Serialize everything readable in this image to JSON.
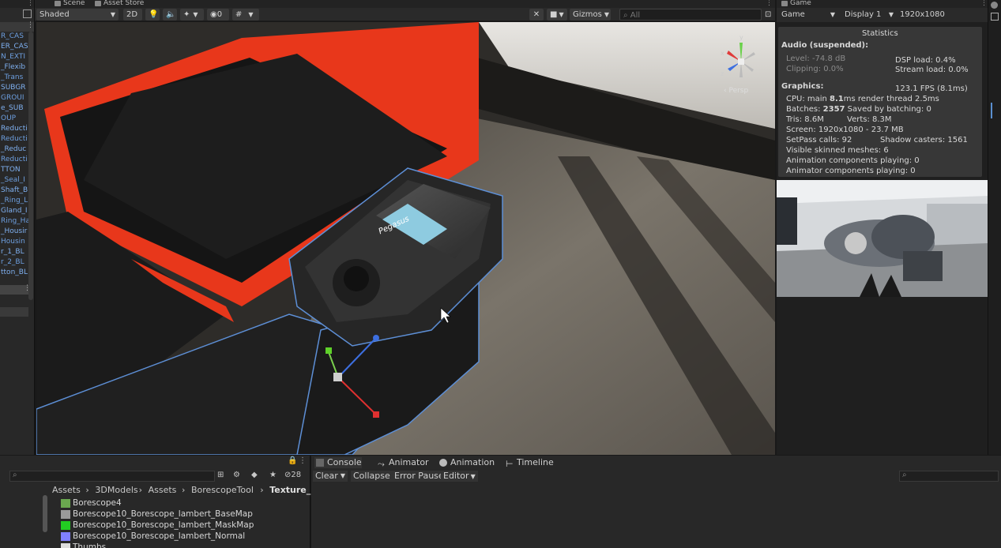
{
  "scene_tabs": {
    "scene": "Scene",
    "asset_store": "Asset Store"
  },
  "scene_toolbar": {
    "shading": "Shaded",
    "mode_2d": "2D",
    "hidden_count": "0",
    "gizmos": "Gizmos",
    "search_placeholder": "All",
    "persp_label": "‹ Persp"
  },
  "hierarchy_items": [
    "R_CAS",
    "ER_CAS",
    "N_EXTI",
    "_Flexib",
    "_Trans",
    "SUBGR",
    "GROUI",
    "e_SUB",
    "OUP",
    "Reducti",
    "Reducti",
    "_Reduc",
    "Reducti",
    "TTON",
    "_Seal_I",
    "Shaft_B",
    "_Ring_L",
    "Gland_I",
    "Ring_Ha",
    "_Housir",
    "Housin",
    "r_1_BL",
    "r_2_BL",
    "tton_BL"
  ],
  "game": {
    "tab": "Game",
    "view": "Game",
    "display": "Display 1",
    "resolution": "1920x1080"
  },
  "stats": {
    "title": "Statistics",
    "audio_header": "Audio (suspended):",
    "level": "Level: -74.8 dB",
    "clipping": "Clipping: 0.0%",
    "dsp": "DSP load: 0.4%",
    "stream": "Stream load: 0.0%",
    "graphics_header": "Graphics:",
    "fps": "123.1 FPS (8.1ms)",
    "cpu_a": "CPU: main ",
    "cpu_b": "8.1",
    "cpu_c": "ms  render thread 2.5ms",
    "batches_a": "Batches: ",
    "batches_b": "2357",
    "batches_c": "  Saved by batching: 0",
    "tris": "Tris: 8.6M",
    "verts": "Verts: 8.3M",
    "screen": "Screen: 1920x1080 - 23.7 MB",
    "setpass": "SetPass calls: 92",
    "shadow": "Shadow casters: 1561",
    "skinned": "Visible skinned meshes: 6",
    "anim": "Animation components playing: 0",
    "animator": "Animator components playing: 0"
  },
  "device_label": "Pegasus",
  "bottom_tabs": {
    "console": "Console",
    "animator": "Animator",
    "animation": "Animation",
    "timeline": "Timeline"
  },
  "console_buttons": {
    "clear": "Clear",
    "collapse": "Collapse",
    "error_pause": "Error Pause",
    "editor": "Editor"
  },
  "project": {
    "hidden_count": "28",
    "breadcrumb": [
      "Assets",
      "3DModels",
      "Assets",
      "BorescopeTool",
      "Texture_Maps"
    ],
    "files": [
      {
        "name": "Borescope4",
        "color": "#6aa84f"
      },
      {
        "name": "Borescope10_Borescope_lambert_BaseMap",
        "color": "#9a9a9a"
      },
      {
        "name": "Borescope10_Borescope_lambert_MaskMap",
        "color": "#22cc22"
      },
      {
        "name": "Borescope10_Borescope_lambert_Normal",
        "color": "#8080ff"
      },
      {
        "name": "Thumbs",
        "color": "#dddddd"
      }
    ]
  }
}
